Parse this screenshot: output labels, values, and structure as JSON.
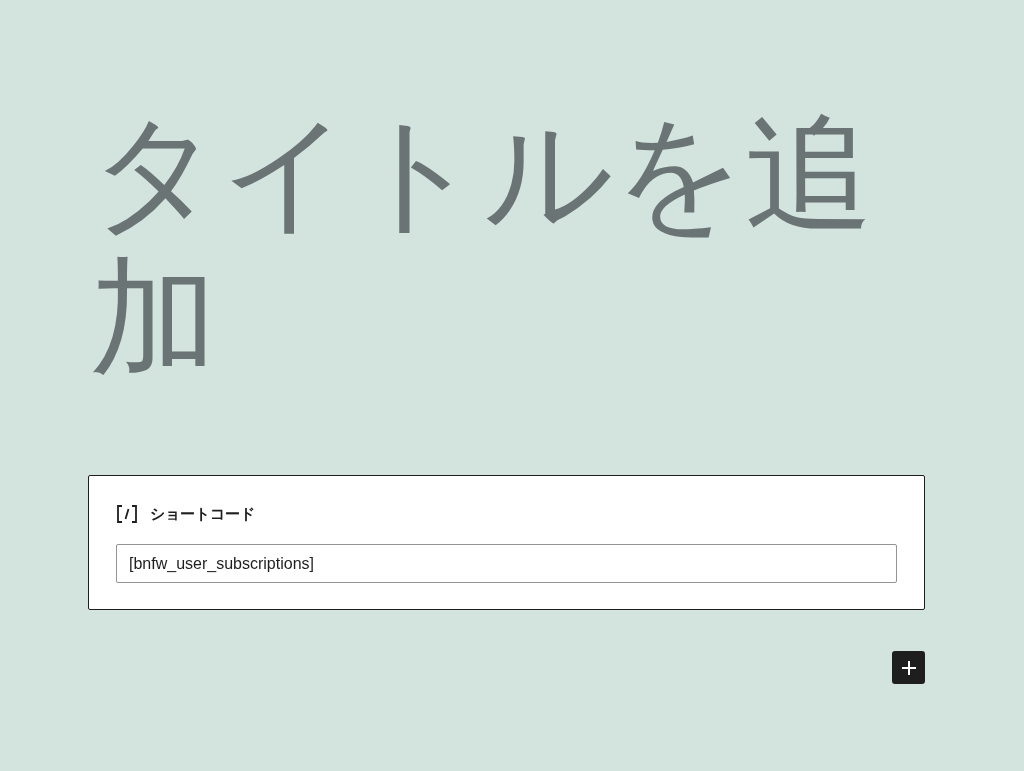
{
  "title_placeholder": "タイトルを追加",
  "shortcode_block": {
    "label": "ショートコード",
    "value": "[bnfw_user_subscriptions]"
  }
}
